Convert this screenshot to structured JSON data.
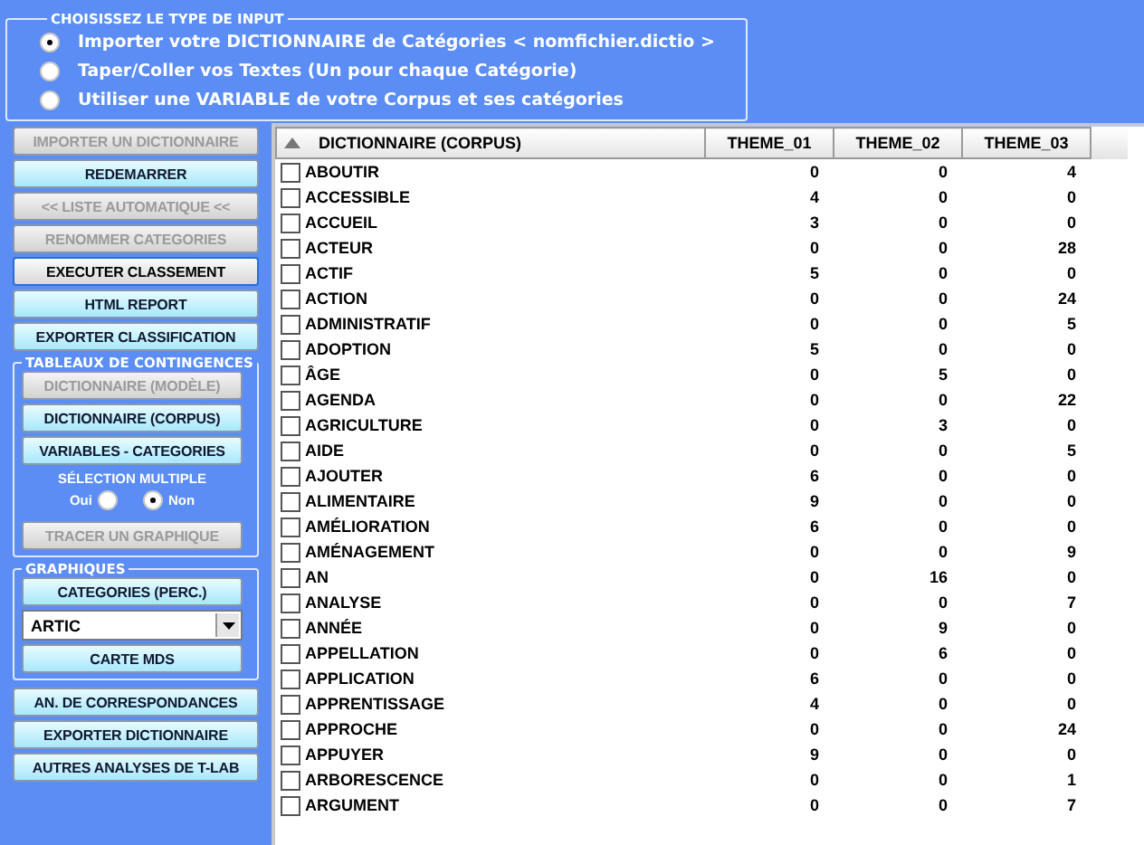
{
  "input_type": {
    "title": "CHOISISSEZ LE TYPE DE INPUT",
    "options": [
      {
        "label": "Importer votre DICTIONNAIRE de Catégories < nomfichier.dictio >",
        "selected": true
      },
      {
        "label": "Taper/Coller vos Textes (Un pour chaque Catégorie)",
        "selected": false
      },
      {
        "label": "Utiliser une VARIABLE de votre Corpus et ses catégories",
        "selected": false
      }
    ]
  },
  "sidebar": {
    "top_buttons": [
      {
        "label": "IMPORTER UN DICTIONNAIRE",
        "disabled": true,
        "focused": false
      },
      {
        "label": "REDEMARRER",
        "disabled": false,
        "focused": false
      },
      {
        "label": "<< LISTE AUTOMATIQUE <<",
        "disabled": true,
        "focused": false
      },
      {
        "label": "RENOMMER CATEGORIES",
        "disabled": true,
        "focused": false
      },
      {
        "label": "EXECUTER CLASSEMENT",
        "disabled": false,
        "focused": true
      },
      {
        "label": "HTML REPORT",
        "disabled": false,
        "focused": false
      },
      {
        "label": "EXPORTER CLASSIFICATION",
        "disabled": false,
        "focused": false
      }
    ],
    "contingency": {
      "title": "TABLEAUX DE CONTINGENCES",
      "buttons": [
        {
          "label": "DICTIONNAIRE (MODÈLE)",
          "disabled": true,
          "focused": false
        },
        {
          "label": "DICTIONNAIRE (CORPUS)",
          "disabled": false,
          "focused": false
        },
        {
          "label": "VARIABLES - CATEGORIES",
          "disabled": false,
          "focused": false
        }
      ],
      "multi_label": "SÉLECTION MULTIPLE",
      "multi_options": [
        {
          "label": "Oui",
          "selected": false
        },
        {
          "label": "Non",
          "selected": true
        }
      ],
      "plot_button": {
        "label": "TRACER UN GRAPHIQUE",
        "disabled": true,
        "focused": false
      }
    },
    "graphics": {
      "title": "GRAPHIQUES",
      "categories_button": {
        "label": "CATEGORIES  (PERC.)",
        "disabled": false,
        "focused": false
      },
      "dropdown": {
        "value": "ARTIC"
      },
      "mds_button": {
        "label": "CARTE  MDS",
        "disabled": false,
        "focused": false
      }
    },
    "bottom_buttons": [
      {
        "label": "AN. DE CORRESPONDANCES",
        "disabled": false,
        "focused": false
      },
      {
        "label": "EXPORTER DICTIONNAIRE",
        "disabled": false,
        "focused": false
      },
      {
        "label": "AUTRES ANALYSES DE T-LAB",
        "disabled": false,
        "focused": false
      }
    ]
  },
  "table": {
    "columns": [
      "DICTIONNAIRE (CORPUS)",
      "THEME_01",
      "THEME_02",
      "THEME_03"
    ],
    "rows": [
      {
        "word": "ABOUTIR",
        "checked": false,
        "values": [
          "0",
          "0",
          "4"
        ]
      },
      {
        "word": "ACCESSIBLE",
        "checked": false,
        "values": [
          "4",
          "0",
          "0"
        ]
      },
      {
        "word": "ACCUEIL",
        "checked": false,
        "values": [
          "3",
          "0",
          "0"
        ]
      },
      {
        "word": "ACTEUR",
        "checked": false,
        "values": [
          "0",
          "0",
          "28"
        ]
      },
      {
        "word": "ACTIF",
        "checked": false,
        "values": [
          "5",
          "0",
          "0"
        ]
      },
      {
        "word": "ACTION",
        "checked": false,
        "values": [
          "0",
          "0",
          "24"
        ]
      },
      {
        "word": "ADMINISTRATIF",
        "checked": false,
        "values": [
          "0",
          "0",
          "5"
        ]
      },
      {
        "word": "ADOPTION",
        "checked": false,
        "values": [
          "5",
          "0",
          "0"
        ]
      },
      {
        "word": "ÂGE",
        "checked": false,
        "values": [
          "0",
          "5",
          "0"
        ]
      },
      {
        "word": "AGENDA",
        "checked": false,
        "values": [
          "0",
          "0",
          "22"
        ]
      },
      {
        "word": "AGRICULTURE",
        "checked": false,
        "values": [
          "0",
          "3",
          "0"
        ]
      },
      {
        "word": "AIDE",
        "checked": false,
        "values": [
          "0",
          "0",
          "5"
        ]
      },
      {
        "word": "AJOUTER",
        "checked": false,
        "values": [
          "6",
          "0",
          "0"
        ]
      },
      {
        "word": "ALIMENTAIRE",
        "checked": false,
        "values": [
          "9",
          "0",
          "0"
        ]
      },
      {
        "word": "AMÉLIORATION",
        "checked": false,
        "values": [
          "6",
          "0",
          "0"
        ]
      },
      {
        "word": "AMÉNAGEMENT",
        "checked": false,
        "values": [
          "0",
          "0",
          "9"
        ]
      },
      {
        "word": "AN",
        "checked": false,
        "values": [
          "0",
          "16",
          "0"
        ]
      },
      {
        "word": "ANALYSE",
        "checked": false,
        "values": [
          "0",
          "0",
          "7"
        ]
      },
      {
        "word": "ANNÉE",
        "checked": false,
        "values": [
          "0",
          "9",
          "0"
        ]
      },
      {
        "word": "APPELLATION",
        "checked": false,
        "values": [
          "0",
          "6",
          "0"
        ]
      },
      {
        "word": "APPLICATION",
        "checked": false,
        "values": [
          "6",
          "0",
          "0"
        ]
      },
      {
        "word": "APPRENTISSAGE",
        "checked": false,
        "values": [
          "4",
          "0",
          "0"
        ]
      },
      {
        "word": "APPROCHE",
        "checked": false,
        "values": [
          "0",
          "0",
          "24"
        ]
      },
      {
        "word": "APPUYER",
        "checked": false,
        "values": [
          "9",
          "0",
          "0"
        ]
      },
      {
        "word": "ARBORESCENCE",
        "checked": false,
        "values": [
          "0",
          "0",
          "1"
        ]
      },
      {
        "word": "ARGUMENT",
        "checked": false,
        "values": [
          "0",
          "0",
          "7"
        ]
      }
    ]
  }
}
